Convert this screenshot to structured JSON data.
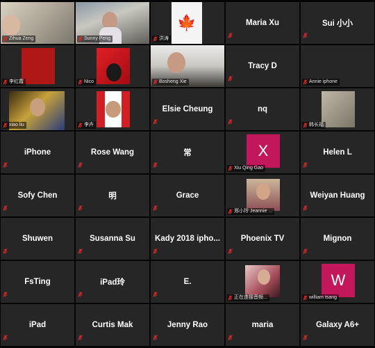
{
  "colors": {
    "tile_bg": "#262626",
    "page_bg": "#050505",
    "mute": "#e02a2a",
    "avatar_magenta": "#c2185b"
  },
  "tiles": [
    {
      "kind": "video",
      "tag": "Zihua Zeng",
      "thumb": "wall"
    },
    {
      "kind": "video",
      "tag": "Sunny Peng",
      "thumb": "room"
    },
    {
      "kind": "video",
      "tag": "洪涛",
      "thumb": "flag-canada"
    },
    {
      "kind": "name",
      "display": "Maria Xu"
    },
    {
      "kind": "name",
      "display": "Sui 小小"
    },
    {
      "kind": "video",
      "tag": "李红霞",
      "thumb": "sign"
    },
    {
      "kind": "video",
      "tag": "Nico",
      "thumb": "red"
    },
    {
      "kind": "video",
      "tag": "Bosheng Xie",
      "thumb": "window"
    },
    {
      "kind": "name",
      "display": "Tracy D"
    },
    {
      "kind": "name",
      "display": "",
      "tag": "Annie iphone"
    },
    {
      "kind": "video",
      "tag": "xiao liu",
      "thumb": "crest"
    },
    {
      "kind": "video",
      "tag": "李卉",
      "thumb": "flagperson"
    },
    {
      "kind": "name",
      "display": "Elsie Cheung"
    },
    {
      "kind": "name",
      "display": "nq"
    },
    {
      "kind": "video",
      "tag": "韩长福",
      "thumb": "grey"
    },
    {
      "kind": "name",
      "display": "iPhone"
    },
    {
      "kind": "name",
      "display": "Rose Wang"
    },
    {
      "kind": "name",
      "display": "常"
    },
    {
      "kind": "avatar",
      "letter": "X",
      "tag": "Xiu Qing Gao"
    },
    {
      "kind": "name",
      "display": "Helen L"
    },
    {
      "kind": "name",
      "display": "Sofy Chen"
    },
    {
      "kind": "name",
      "display": "明"
    },
    {
      "kind": "name",
      "display": "Grace"
    },
    {
      "kind": "video",
      "tag": "郑小玲 Jeannie ...",
      "thumb": "portrait"
    },
    {
      "kind": "name",
      "display": "Weiyan Huang"
    },
    {
      "kind": "name",
      "display": "Shuwen"
    },
    {
      "kind": "name",
      "display": "Susanna Su"
    },
    {
      "kind": "name",
      "display": "Kady 2018 ipho..."
    },
    {
      "kind": "name",
      "display": "Phoenix TV"
    },
    {
      "kind": "name",
      "display": "Mignon"
    },
    {
      "kind": "name",
      "display": "FsTing"
    },
    {
      "kind": "name",
      "display": "iPad玲"
    },
    {
      "kind": "name",
      "display": "E."
    },
    {
      "kind": "video",
      "tag": "正在连接音频...",
      "thumb": "group"
    },
    {
      "kind": "avatar",
      "letter": "W",
      "tag": "william tsang"
    },
    {
      "kind": "name",
      "display": "iPad"
    },
    {
      "kind": "name",
      "display": "Curtis Mak"
    },
    {
      "kind": "name",
      "display": "Jenny Rao"
    },
    {
      "kind": "name",
      "display": "maria"
    },
    {
      "kind": "name",
      "display": "Galaxy A6+"
    }
  ]
}
